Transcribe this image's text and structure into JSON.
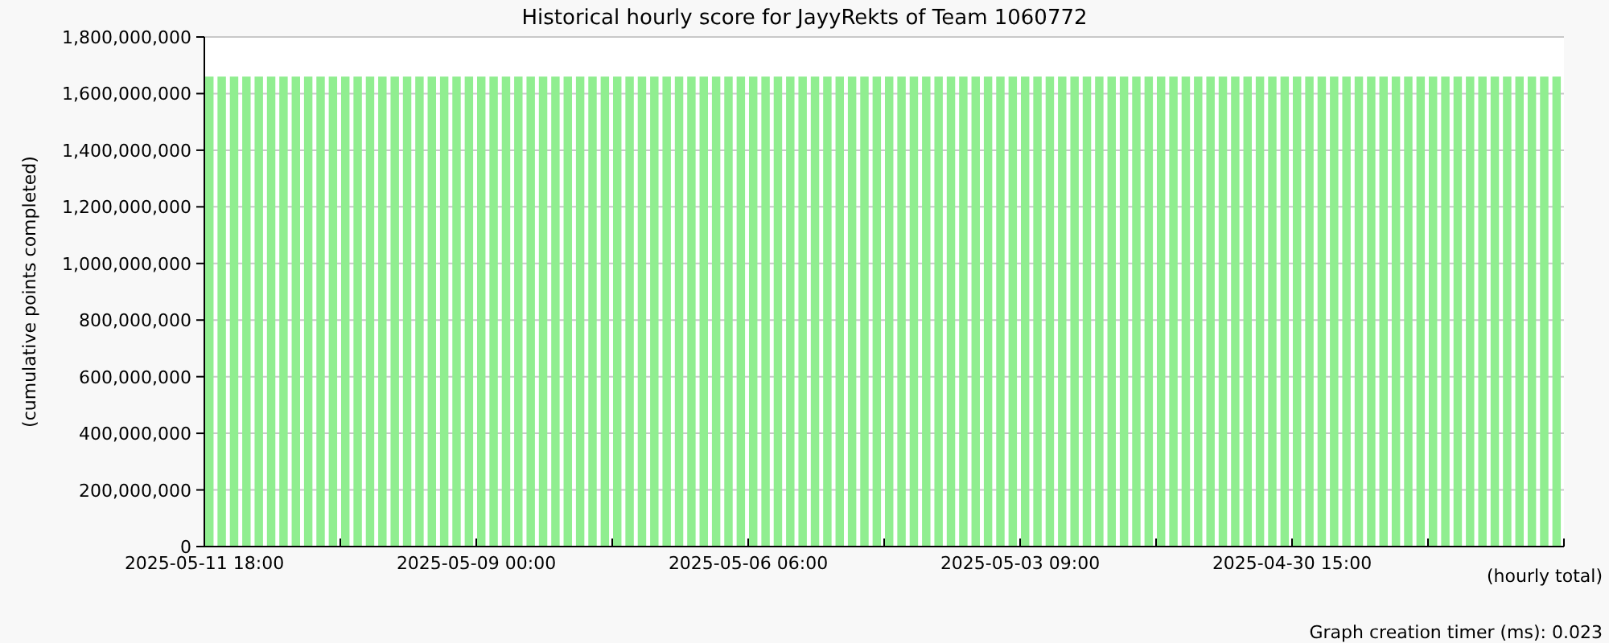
{
  "chart_data": {
    "type": "bar",
    "title": "Historical hourly score for JayyRekts of Team 1060772",
    "xlabel": "(hourly total)",
    "ylabel": "(cumulative points completed)",
    "grid": true,
    "categories": [
      "2025-05-11 18:00",
      null,
      null,
      null,
      null,
      null,
      null,
      null,
      null,
      null,
      null,
      null,
      null,
      null,
      null,
      null,
      null,
      null,
      null,
      null,
      null,
      null,
      "2025-05-09 00:00",
      null,
      null,
      null,
      null,
      null,
      null,
      null,
      null,
      null,
      null,
      null,
      null,
      null,
      null,
      null,
      null,
      null,
      null,
      null,
      null,
      null,
      "2025-05-06 06:00",
      null,
      null,
      null,
      null,
      null,
      null,
      null,
      null,
      null,
      null,
      null,
      null,
      null,
      null,
      null,
      null,
      null,
      null,
      null,
      null,
      null,
      "2025-05-03 09:00",
      null,
      null,
      null,
      null,
      null,
      null,
      null,
      null,
      null,
      null,
      null,
      null,
      null,
      null,
      null,
      null,
      null,
      null,
      null,
      null,
      null,
      "2025-04-30 15:00",
      null,
      null,
      null,
      null,
      null,
      null,
      null,
      null,
      null,
      null,
      null,
      null,
      null,
      null,
      null,
      null,
      null,
      null,
      null,
      null,
      null
    ],
    "series": [
      {
        "color": "#90ee90",
        "values": [
          1660000000,
          1660000000,
          1660000000,
          1660000000,
          1660000000,
          1660000000,
          1660000000,
          1660000000,
          1660000000,
          1660000000,
          1660000000,
          1660000000,
          1660000000,
          1660000000,
          1660000000,
          1660000000,
          1660000000,
          1660000000,
          1660000000,
          1660000000,
          1660000000,
          1660000000,
          1660000000,
          1660000000,
          1660000000,
          1660000000,
          1660000000,
          1660000000,
          1660000000,
          1660000000,
          1660000000,
          1660000000,
          1660000000,
          1660000000,
          1660000000,
          1660000000,
          1660000000,
          1660000000,
          1660000000,
          1660000000,
          1660000000,
          1660000000,
          1660000000,
          1660000000,
          1660000000,
          1660000000,
          1660000000,
          1660000000,
          1660000000,
          1660000000,
          1660000000,
          1660000000,
          1660000000,
          1660000000,
          1660000000,
          1660000000,
          1660000000,
          1660000000,
          1660000000,
          1660000000,
          1660000000,
          1660000000,
          1660000000,
          1660000000,
          1660000000,
          1660000000,
          1660000000,
          1660000000,
          1660000000,
          1660000000,
          1660000000,
          1660000000,
          1660000000,
          1660000000,
          1660000000,
          1660000000,
          1660000000,
          1660000000,
          1660000000,
          1660000000,
          1660000000,
          1660000000,
          1660000000,
          1660000000,
          1660000000,
          1660000000,
          1660000000,
          1660000000,
          1660000000,
          1660000000,
          1660000000,
          1660000000,
          1660000000,
          1660000000,
          1660000000,
          1660000000,
          1660000000,
          1660000000,
          1660000000,
          1660000000,
          1660000000,
          1660000000,
          1660000000,
          1660000000,
          1660000000,
          1660000000,
          1660000000,
          1660000000,
          1660000000,
          1660000000
        ]
      }
    ],
    "ylim": [
      0,
      1800000000
    ],
    "yticks": [
      {
        "value": 0,
        "label": "0"
      },
      {
        "value": 200000000,
        "label": "200,000,000"
      },
      {
        "value": 400000000,
        "label": "400,000,000"
      },
      {
        "value": 600000000,
        "label": "600,000,000"
      },
      {
        "value": 800000000,
        "label": "800,000,000"
      },
      {
        "value": 1000000000,
        "label": "1,000,000,000"
      },
      {
        "value": 1200000000,
        "label": "1,200,000,000"
      },
      {
        "value": 1400000000,
        "label": "1,400,000,000"
      },
      {
        "value": 1600000000,
        "label": "1,600,000,000"
      },
      {
        "value": 1800000000,
        "label": "1,800,000,000"
      }
    ]
  },
  "footer": "Graph creation timer (ms): 0.023"
}
